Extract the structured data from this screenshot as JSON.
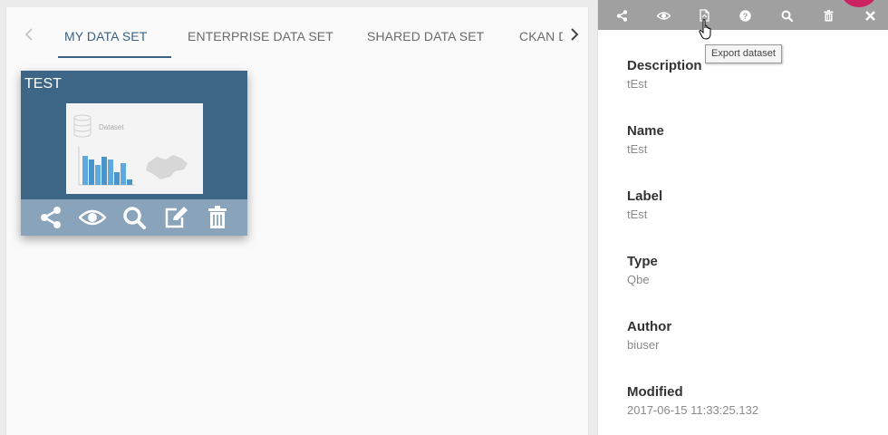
{
  "tabs": {
    "items": [
      {
        "label": "MY DATA SET",
        "active": true
      },
      {
        "label": "ENTERPRISE DATA SET",
        "active": false
      },
      {
        "label": "SHARED DATA SET",
        "active": false
      },
      {
        "label": "CKAN D",
        "active": false
      }
    ],
    "prev_icon": "chevron-left-icon",
    "next_icon": "chevron-right-icon"
  },
  "card": {
    "title": "TEST",
    "thumbnail_label": "Dataset",
    "actions": [
      "share-icon",
      "eye-icon",
      "search-icon",
      "edit-icon",
      "trash-icon"
    ]
  },
  "detail_toolbar": {
    "buttons": [
      "share-icon",
      "eye-icon",
      "export-file-icon",
      "help-icon",
      "search-icon",
      "trash-icon",
      "close-icon"
    ],
    "tooltip": "Export dataset"
  },
  "details": [
    {
      "label": "Description",
      "value": "tEst"
    },
    {
      "label": "Name",
      "value": "tEst"
    },
    {
      "label": "Label",
      "value": "tEst"
    },
    {
      "label": "Type",
      "value": "Qbe"
    },
    {
      "label": "Author",
      "value": "biuser"
    },
    {
      "label": "Modified",
      "value": "2017-06-15 11:33:25.132"
    }
  ],
  "colors": {
    "primary": "#3d6586",
    "tab_active": "#3b6185",
    "card_actions": "#89a3ba",
    "toolbar": "#a0a0a0",
    "fab": "#cc2262"
  }
}
